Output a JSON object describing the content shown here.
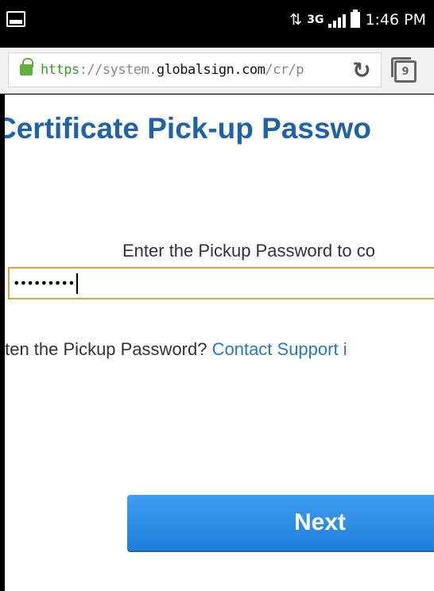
{
  "status_bar": {
    "network": "3G",
    "time": "1:46 PM"
  },
  "browser": {
    "url_scheme": "https",
    "url_pre": "://system.",
    "url_host": "globalsign.com",
    "url_path": "/cr/p",
    "tab_count": "9"
  },
  "page": {
    "title": "Certificate Pick-up Passwo",
    "instruction": "Enter the Pickup Password to co",
    "password_value": "•••••••••",
    "forgot_text": "tten the Pickup Password? ",
    "support_link": "Contact Support i",
    "next_label": "Next"
  },
  "colors": {
    "title": "#1e63aa",
    "link": "#2a78c3",
    "button": "#2b8be6",
    "field_border": "#e0a43c",
    "url_scheme": "#3a9a2c"
  },
  "icons": [
    "gallery-icon",
    "data-transfer-icon",
    "signal-icon",
    "battery-icon",
    "lock-icon",
    "reload-icon",
    "tabs-icon"
  ]
}
